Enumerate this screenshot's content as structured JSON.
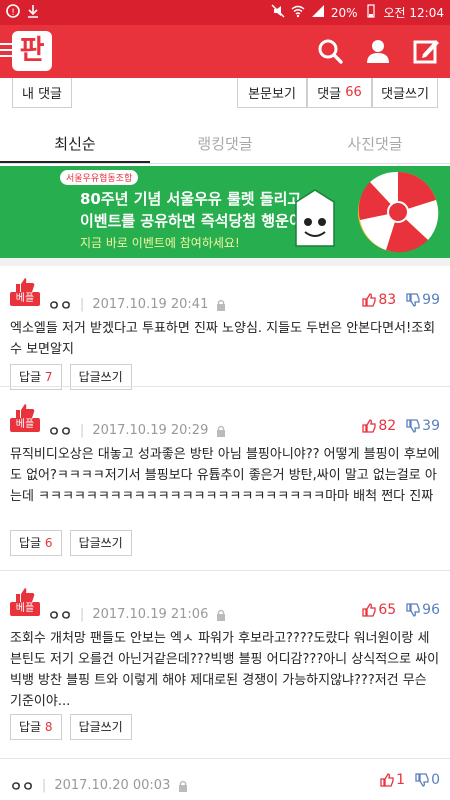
{
  "status_bar": {
    "battery": "20%",
    "time": "오전 12:04"
  },
  "header": {
    "logo": "판"
  },
  "actions": {
    "my_comments": "내 댓글",
    "view_article": "본문보기",
    "comments_label": "댓글",
    "comments_count": "66",
    "write_comment": "댓글쓰기"
  },
  "tabs": [
    "최신순",
    "랭킹댓글",
    "사진댓글"
  ],
  "banner": {
    "brand": "서울우유협동조합",
    "line1": "80주년 기념 서울우유 룰렛 돌리고",
    "line2": "이벤트를 공유하면 즉석당첨 행운이!",
    "line3": "지금 바로 이벤트에 참여하세요!"
  },
  "comments": [
    {
      "badge": "베플",
      "author": "ㅇㅇ",
      "date": "2017.10.19 20:41",
      "up": "83",
      "down": "99",
      "text": "엑소엘들 저거 받겠다고 투표하면 진짜 노양심. 지들도 두번은 안본다면서!조회수 보면알지",
      "reply_label": "답글",
      "reply_count": "7",
      "write_reply": "답글쓰기"
    },
    {
      "badge": "베플",
      "author": "ㅇㅇ",
      "date": "2017.10.19 20:29",
      "up": "82",
      "down": "39",
      "text": "뮤직비디오상은 대놓고 성과좋은 방탄 아님 블핑아니야?? 어떻게 블핑이 후보에도 없어?ㅋㅋㅋㅋ저기서 블핑보다 유튭추이 좋은거 방탄,싸이 말고 없는걸로 아는데 ㅋㅋㅋㅋㅋㅋㅋㅋㅋㅋㅋㅋㅋㅋㅋㅋㅋㅋㅋㅋㅋㅋㅋㅋ마마 배척 쩐다 진짜",
      "reply_label": "답글",
      "reply_count": "6",
      "write_reply": "답글쓰기"
    },
    {
      "badge": "베플",
      "author": "ㅇㅇ",
      "date": "2017.10.19 21:06",
      "up": "65",
      "down": "96",
      "text": "조회수 개처망 팬들도 안보는 엑ㅅ 파워가 후보라고????도랐다 워너원이랑 세븐틴도 저기 오를건 아닌거같은데???빅뱅 블핑 어디감???아니 상식적으로 싸이 빅뱅 방찬 블핑 트와 이렇게 해야 제대로된 경쟁이 가능하지않냐???저건 무슨 기준이야...",
      "reply_label": "답글",
      "reply_count": "8",
      "write_reply": "답글쓰기"
    },
    {
      "author": "ㅇㅇ",
      "date": "2017.10.20 00:03",
      "up": "1",
      "down": "0"
    }
  ]
}
